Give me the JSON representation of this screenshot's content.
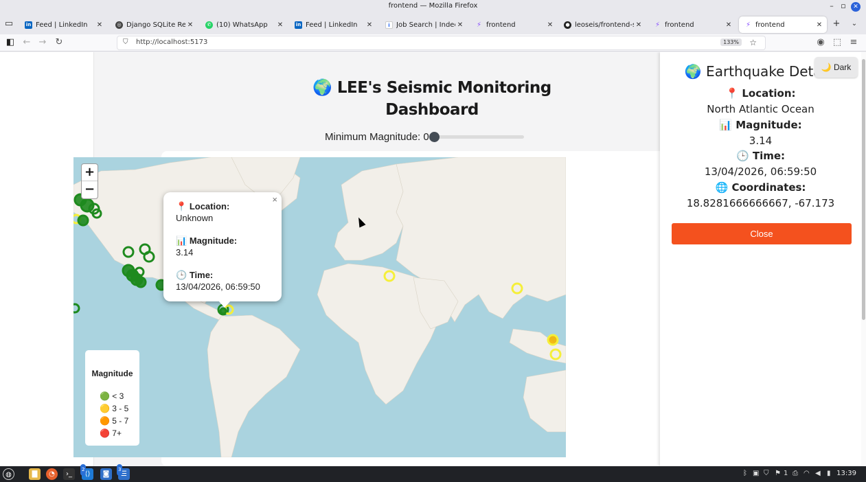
{
  "window": {
    "title": "frontend — Mozilla Firefox"
  },
  "tabs": [
    {
      "label": "Feed | LinkedIn",
      "favicon": "linkedin-icon"
    },
    {
      "label": "Django SQLite Render D",
      "favicon": "django-icon"
    },
    {
      "label": "(10) WhatsApp",
      "favicon": "whatsapp-icon"
    },
    {
      "label": "Feed | LinkedIn",
      "favicon": "linkedin-icon"
    },
    {
      "label": "Job Search | Indeed",
      "favicon": "indeed-icon"
    },
    {
      "label": "frontend",
      "favicon": "vite-icon"
    },
    {
      "label": "leoseis/frontend-seismi",
      "favicon": "github-icon"
    },
    {
      "label": "frontend",
      "favicon": "vite-icon"
    },
    {
      "label": "frontend",
      "favicon": "vite-icon",
      "active": true
    }
  ],
  "navbar": {
    "url": "http://localhost:5173",
    "zoom": "133%"
  },
  "app": {
    "title_icon": "🌍",
    "title_line1": "LEE's Seismic Monitoring",
    "title_line2": "Dashboard",
    "slider_label": "Minimum Magnitude: 0",
    "min_magnitude": 0
  },
  "map": {
    "zoom_in": "+",
    "zoom_out": "−",
    "popup": {
      "close": "×",
      "location_icon": "📍",
      "location_label": "Location:",
      "location_value": "Unknown",
      "magnitude_icon": "📊",
      "magnitude_label": "Magnitude:",
      "magnitude_value": "3.14",
      "time_icon": "🕒",
      "time_label": "Time:",
      "time_value": "13/04/2026, 06:59:50"
    },
    "legend": {
      "title": "Magnitude",
      "items": [
        {
          "dot": "🟢",
          "label": "< 3",
          "color": "#2e9a2e"
        },
        {
          "dot": "🟡",
          "label": "3 - 5",
          "color": "#f5c518"
        },
        {
          "dot": "🟠",
          "label": "5 - 7",
          "color": "#f08a00"
        },
        {
          "dot": "🔴",
          "label": "7+",
          "color": "#e53935"
        }
      ]
    },
    "colors": {
      "ocean": "#aad3df",
      "land": "#f2efe9",
      "green": "#1e8a1e",
      "yellow": "#f5ef3a",
      "orange": "#f5b400"
    }
  },
  "panel": {
    "title": "🌍 Earthquake Details",
    "location_head": "📍 Location:",
    "location_value": "North Atlantic Ocean",
    "magnitude_head": "📊 Magnitude:",
    "magnitude_value": "3.14",
    "time_head": "🕒 Time:",
    "time_value": "13/04/2026, 06:59:50",
    "coords_head": "🌐 Coordinates:",
    "coords_value": "18.8281666666667, -67.173",
    "close_label": "Close",
    "dark_label": "🌙 Dark",
    "accent": "#f4511e"
  },
  "taskbar": {
    "clock": "13:39",
    "badge_code": "2",
    "badge_files": "3",
    "tray_count": "1"
  }
}
